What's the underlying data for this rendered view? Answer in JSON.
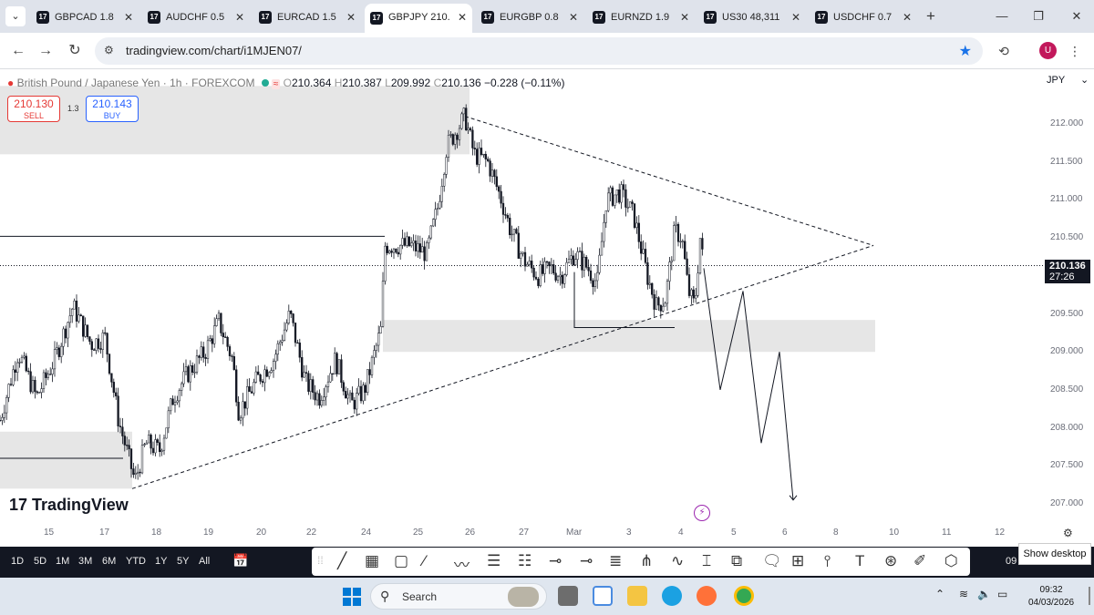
{
  "browser": {
    "tabs": [
      {
        "label": "GBPCAD 1.8",
        "active": false
      },
      {
        "label": "AUDCHF 0.5",
        "active": false
      },
      {
        "label": "EURCAD 1.5",
        "active": false
      },
      {
        "label": "GBPJPY 210.",
        "active": true
      },
      {
        "label": "EURGBP 0.8",
        "active": false
      },
      {
        "label": "EURNZD 1.9",
        "active": false
      },
      {
        "label": "US30 48,311",
        "active": false
      },
      {
        "label": "USDCHF 0.7",
        "active": false
      }
    ],
    "url": "tradingview.com/chart/i1MJEN07/",
    "avatar": "U",
    "icons": {
      "back": "back-arrow-icon",
      "forward": "forward-arrow-icon",
      "reload": "reload-icon",
      "bookmark": "star-icon",
      "history": "history-icon",
      "menu": "kebab-menu-icon"
    }
  },
  "chart": {
    "symbol": "British Pound / Japanese Yen",
    "interval": "1h",
    "exchange": "FOREXCOM",
    "open_label": "O",
    "open": "210.364",
    "high_label": "H",
    "high": "210.387",
    "low_label": "L",
    "low": "209.992",
    "close_label": "C",
    "close": "210.136",
    "change": "−0.228 (−0.11%)",
    "sell_price": "210.130",
    "sell_label": "SELL",
    "buy_price": "210.143",
    "buy_label": "BUY",
    "spread": "1.3",
    "currency": "JPY",
    "current_price": "210.136",
    "countdown": "27:26",
    "logo": "TradingView",
    "colors": {
      "up": "#ffffff",
      "down": "#131722",
      "zone": "#e6e6e6",
      "sell": "#e53935",
      "buy": "#2962ff"
    }
  },
  "chart_data": {
    "type": "candlestick",
    "y_axis_labels": [
      "212.000",
      "211.500",
      "211.000",
      "210.500",
      "209.500",
      "209.000",
      "208.500",
      "208.000",
      "207.500",
      "207.000"
    ],
    "x_axis_labels": [
      "15",
      "17",
      "18",
      "19",
      "20",
      "22",
      "24",
      "25",
      "26",
      "27",
      "Mar",
      "3",
      "4",
      "5",
      "6",
      "8",
      "10",
      "11",
      "12"
    ],
    "ylim": [
      206.9,
      212.5
    ],
    "price_path": [
      [
        0,
        208.1
      ],
      [
        20,
        209.0
      ],
      [
        40,
        208.4
      ],
      [
        60,
        208.9
      ],
      [
        80,
        209.6
      ],
      [
        100,
        209.1
      ],
      [
        115,
        209.2
      ],
      [
        130,
        208.1
      ],
      [
        148,
        207.3
      ],
      [
        160,
        207.8
      ],
      [
        175,
        207.7
      ],
      [
        190,
        208.4
      ],
      [
        205,
        208.7
      ],
      [
        225,
        209.0
      ],
      [
        240,
        209.4
      ],
      [
        255,
        208.9
      ],
      [
        262,
        208.2
      ],
      [
        280,
        208.6
      ],
      [
        300,
        208.9
      ],
      [
        318,
        209.5
      ],
      [
        335,
        208.6
      ],
      [
        350,
        208.4
      ],
      [
        368,
        208.9
      ],
      [
        385,
        208.3
      ],
      [
        400,
        208.5
      ],
      [
        418,
        209.3
      ],
      [
        422,
        210.4
      ],
      [
        435,
        210.4
      ],
      [
        450,
        210.4
      ],
      [
        468,
        210.3
      ],
      [
        480,
        210.9
      ],
      [
        490,
        211.7
      ],
      [
        500,
        211.9
      ],
      [
        510,
        212.1
      ],
      [
        520,
        211.6
      ],
      [
        535,
        211.5
      ],
      [
        550,
        211.0
      ],
      [
        560,
        210.6
      ],
      [
        575,
        210.2
      ],
      [
        590,
        210.0
      ],
      [
        605,
        210.1
      ],
      [
        615,
        210.0
      ],
      [
        630,
        210.3
      ],
      [
        645,
        210.1
      ],
      [
        655,
        209.9
      ],
      [
        665,
        211.0
      ],
      [
        680,
        211.1
      ],
      [
        695,
        210.8
      ],
      [
        710,
        210.0
      ],
      [
        720,
        209.6
      ],
      [
        730,
        209.7
      ],
      [
        740,
        210.6
      ],
      [
        748,
        210.5
      ],
      [
        755,
        209.8
      ],
      [
        762,
        209.6
      ],
      [
        768,
        210.5
      ],
      [
        772,
        210.1
      ]
    ],
    "projection_path": [
      [
        772,
        210.1
      ],
      [
        790,
        208.5
      ],
      [
        815,
        209.8
      ],
      [
        835,
        207.8
      ],
      [
        855,
        209.0
      ],
      [
        870,
        207.05
      ]
    ]
  },
  "bottom": {
    "ranges": [
      "1D",
      "5D",
      "1M",
      "3M",
      "6M",
      "YTD",
      "1Y",
      "5Y",
      "All"
    ],
    "time_partial": "09",
    "show_desktop": "Show desktop"
  },
  "taskbar": {
    "search_placeholder": "Search",
    "time": "09:32",
    "date": "04/03/2026"
  }
}
